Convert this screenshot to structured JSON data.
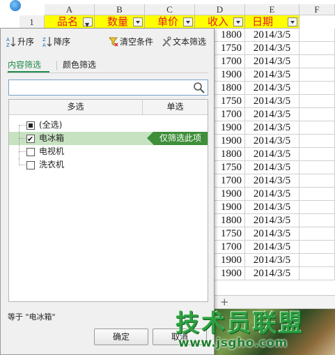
{
  "sheet": {
    "columns": [
      "A",
      "B",
      "C",
      "D",
      "E",
      "F"
    ],
    "header_row_number": "1",
    "headers": [
      "品名",
      "数量",
      "单价",
      "收入",
      "日期"
    ],
    "rows": [
      {
        "income": "1800",
        "date": "2014/3/5"
      },
      {
        "income": "1750",
        "date": "2014/3/5"
      },
      {
        "income": "1700",
        "date": "2014/3/5"
      },
      {
        "income": "1900",
        "date": "2014/3/5"
      },
      {
        "income": "1800",
        "date": "2014/3/5"
      },
      {
        "income": "1750",
        "date": "2014/3/5"
      },
      {
        "income": "1700",
        "date": "2014/3/5"
      },
      {
        "income": "1900",
        "date": "2014/3/5"
      },
      {
        "income": "1900",
        "date": "2014/3/5"
      },
      {
        "income": "1800",
        "date": "2014/3/5"
      },
      {
        "income": "1750",
        "date": "2014/3/5"
      },
      {
        "income": "1700",
        "date": "2014/3/5"
      },
      {
        "income": "1900",
        "date": "2014/3/5"
      },
      {
        "income": "1900",
        "date": "2014/3/5"
      },
      {
        "income": "1800",
        "date": "2014/3/5"
      },
      {
        "income": "1750",
        "date": "2014/3/5"
      },
      {
        "income": "1700",
        "date": "2014/3/5"
      },
      {
        "income": "1900",
        "date": "2014/3/5"
      },
      {
        "income": "1900",
        "date": "2014/3/5"
      }
    ],
    "add_sheet": "+"
  },
  "filter_panel": {
    "toolbar": {
      "sort_asc": "升序",
      "sort_desc": "降序",
      "clear": "清空条件",
      "text_filter": "文本筛选"
    },
    "tabs": {
      "content": "内容筛选",
      "color": "颜色筛选"
    },
    "search": {
      "value": "",
      "placeholder": ""
    },
    "list_header": {
      "multi": "多选",
      "single": "单选"
    },
    "items": [
      {
        "label": "(全选)",
        "state": "partial"
      },
      {
        "label": "电冰箱",
        "state": "checked"
      },
      {
        "label": "电视机",
        "state": "unchecked"
      },
      {
        "label": "洗衣机",
        "state": "unchecked"
      }
    ],
    "only_this_tag": "仅筛选此项",
    "condition_text": "等于 \"电冰箱\"",
    "ok_button": "确定",
    "cancel_button": "取消"
  },
  "watermark": {
    "name": "技术员联盟",
    "url": "www.jsgho.com"
  },
  "colors": {
    "header_fill": "#ffff00",
    "header_text": "#e02020",
    "accent_green": "#1d8a48",
    "highlight_row": "#c7e2c1",
    "tag_green": "#3f8f3a"
  }
}
